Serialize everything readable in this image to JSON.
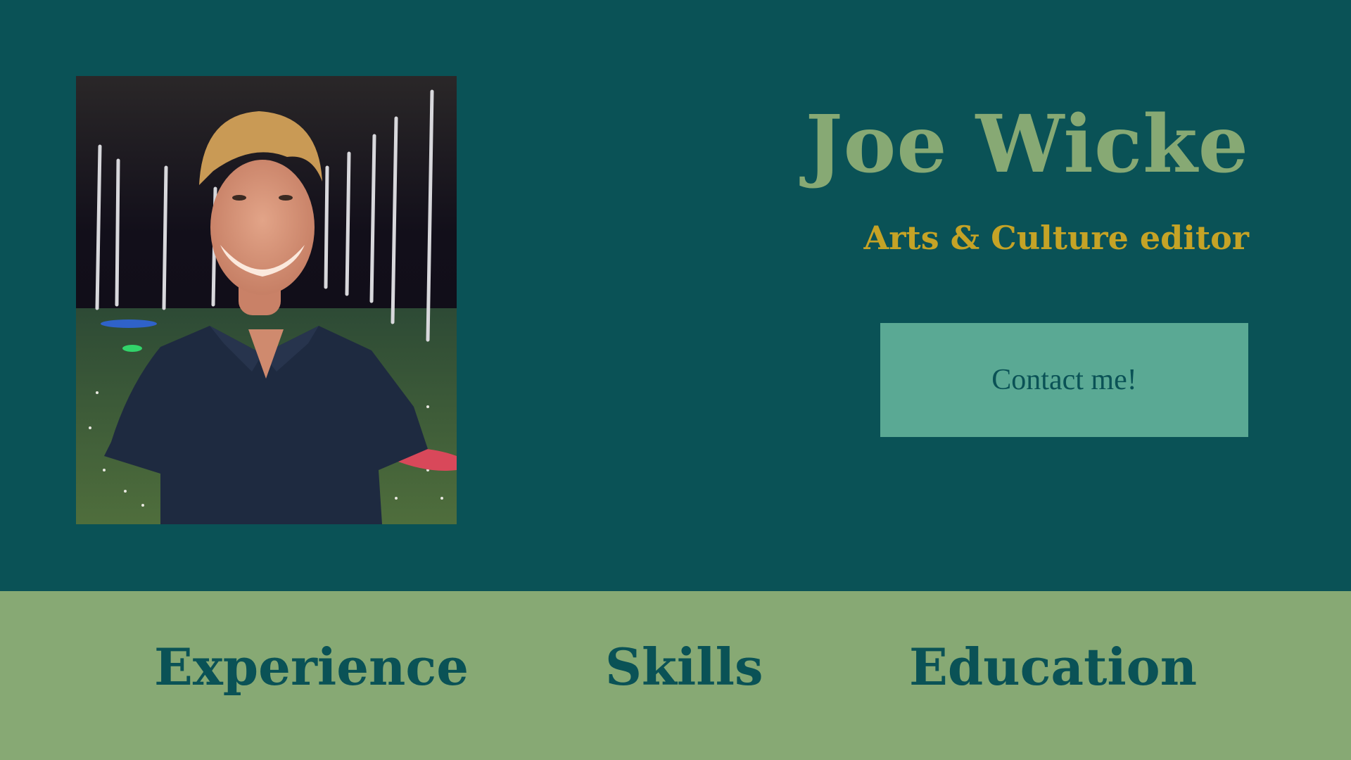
{
  "profile": {
    "name": "Joe Wicke",
    "role": "Arts & Culture editor",
    "contact_label": "Contact me!"
  },
  "nav": {
    "items": [
      {
        "label": "Experience"
      },
      {
        "label": "Skills"
      },
      {
        "label": "Education"
      }
    ]
  },
  "colors": {
    "background": "#0a5256",
    "name": "#87a974",
    "role": "#c5a326",
    "button": "#5aa994",
    "nav_bar": "#87a974",
    "nav_text": "#0a5256"
  }
}
